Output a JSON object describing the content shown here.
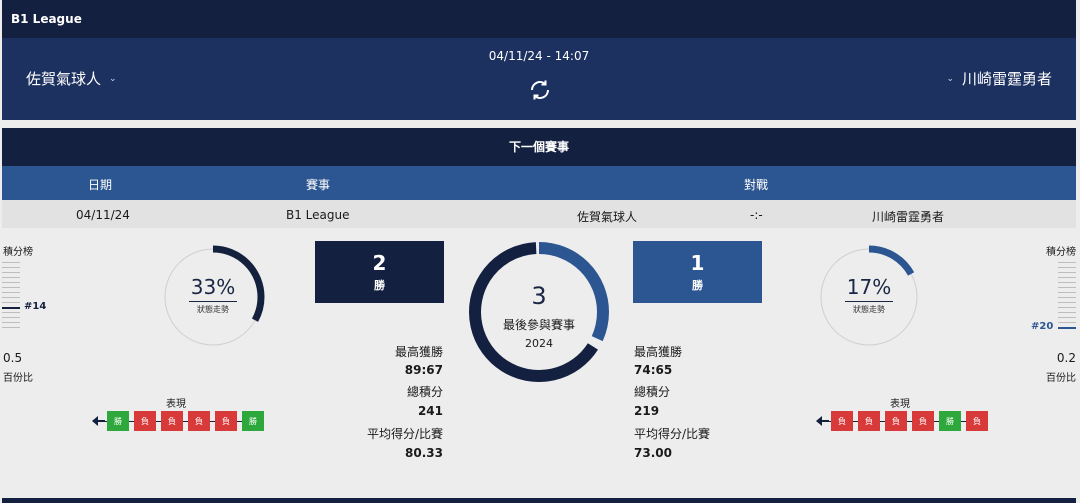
{
  "app": {
    "league": "B1 League"
  },
  "header": {
    "home_team": "佐賀氣球人",
    "away_team": "川崎雷霆勇者",
    "datetime": "04/11/24 - 14:07"
  },
  "next_match": {
    "title": "下一個賽事",
    "columns": {
      "date": "日期",
      "event": "賽事",
      "matchup": "對戰"
    },
    "row": {
      "date": "04/11/24",
      "event": "B1 League",
      "home": "佐賀氣球人",
      "score": "-:-",
      "away": "川崎雷霆勇者"
    }
  },
  "home": {
    "standings_label": "積分榜",
    "rank": "#14",
    "ratio": "0.5",
    "ratio_label": "百份比",
    "form_pct": "33%",
    "form_pct_value": 0.33,
    "form_label": "狀態走勢",
    "wins": "2",
    "wins_label": "勝",
    "perf_label": "表現",
    "performance": [
      {
        "result": "W",
        "label": "勝"
      },
      {
        "result": "L",
        "label": "負"
      },
      {
        "result": "L",
        "label": "負"
      },
      {
        "result": "L",
        "label": "負"
      },
      {
        "result": "L",
        "label": "負"
      },
      {
        "result": "W",
        "label": "勝"
      }
    ],
    "stats": {
      "max_win_label": "最高獲勝",
      "max_win": "89:67",
      "total_label": "總積分",
      "total": "241",
      "avg_label": "平均得分/比賽",
      "avg": "80.33"
    }
  },
  "away": {
    "standings_label": "積分榜",
    "rank": "#20",
    "ratio": "0.2",
    "ratio_label": "百份比",
    "form_pct": "17%",
    "form_pct_value": 0.17,
    "form_label": "狀態走勢",
    "wins": "1",
    "wins_label": "勝",
    "perf_label": "表現",
    "performance": [
      {
        "result": "L",
        "label": "負"
      },
      {
        "result": "L",
        "label": "負"
      },
      {
        "result": "L",
        "label": "負"
      },
      {
        "result": "L",
        "label": "負"
      },
      {
        "result": "W",
        "label": "勝"
      },
      {
        "result": "L",
        "label": "負"
      }
    ],
    "stats": {
      "max_win_label": "最高獲勝",
      "max_win": "74:65",
      "total_label": "總積分",
      "total": "219",
      "avg_label": "平均得分/比賽",
      "avg": "73.00"
    }
  },
  "center": {
    "total": "3",
    "label": "最後參與賽事",
    "year": "2024",
    "home_share": 0.667,
    "away_share": 0.333
  },
  "colors": {
    "dark_navy": "#142040",
    "blue": "#2c5691",
    "win": "#2ea83c",
    "loss": "#d83a3a"
  }
}
